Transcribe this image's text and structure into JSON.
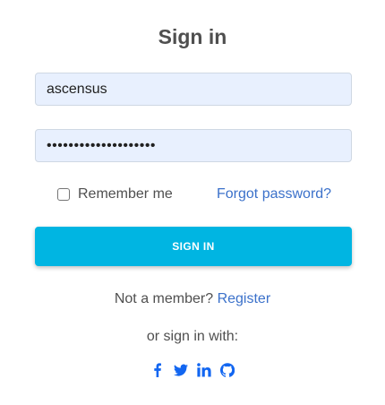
{
  "title": "Sign in",
  "username": {
    "value": "ascensus"
  },
  "password": {
    "value": "••••••••••••••••••••"
  },
  "remember": {
    "label": "Remember me",
    "checked": false
  },
  "forgot_label": "Forgot password?",
  "signin_label": "SIGN IN",
  "register": {
    "prefix": "Not a member? ",
    "link": "Register"
  },
  "social": {
    "heading": "or sign in with:",
    "icons": [
      "facebook-icon",
      "twitter-icon",
      "linkedin-icon",
      "github-icon"
    ],
    "color": "#1266f1"
  },
  "colors": {
    "accent_button": "#00b5e2",
    "link": "#3b71ca",
    "input_fill": "#e8f0fe"
  }
}
